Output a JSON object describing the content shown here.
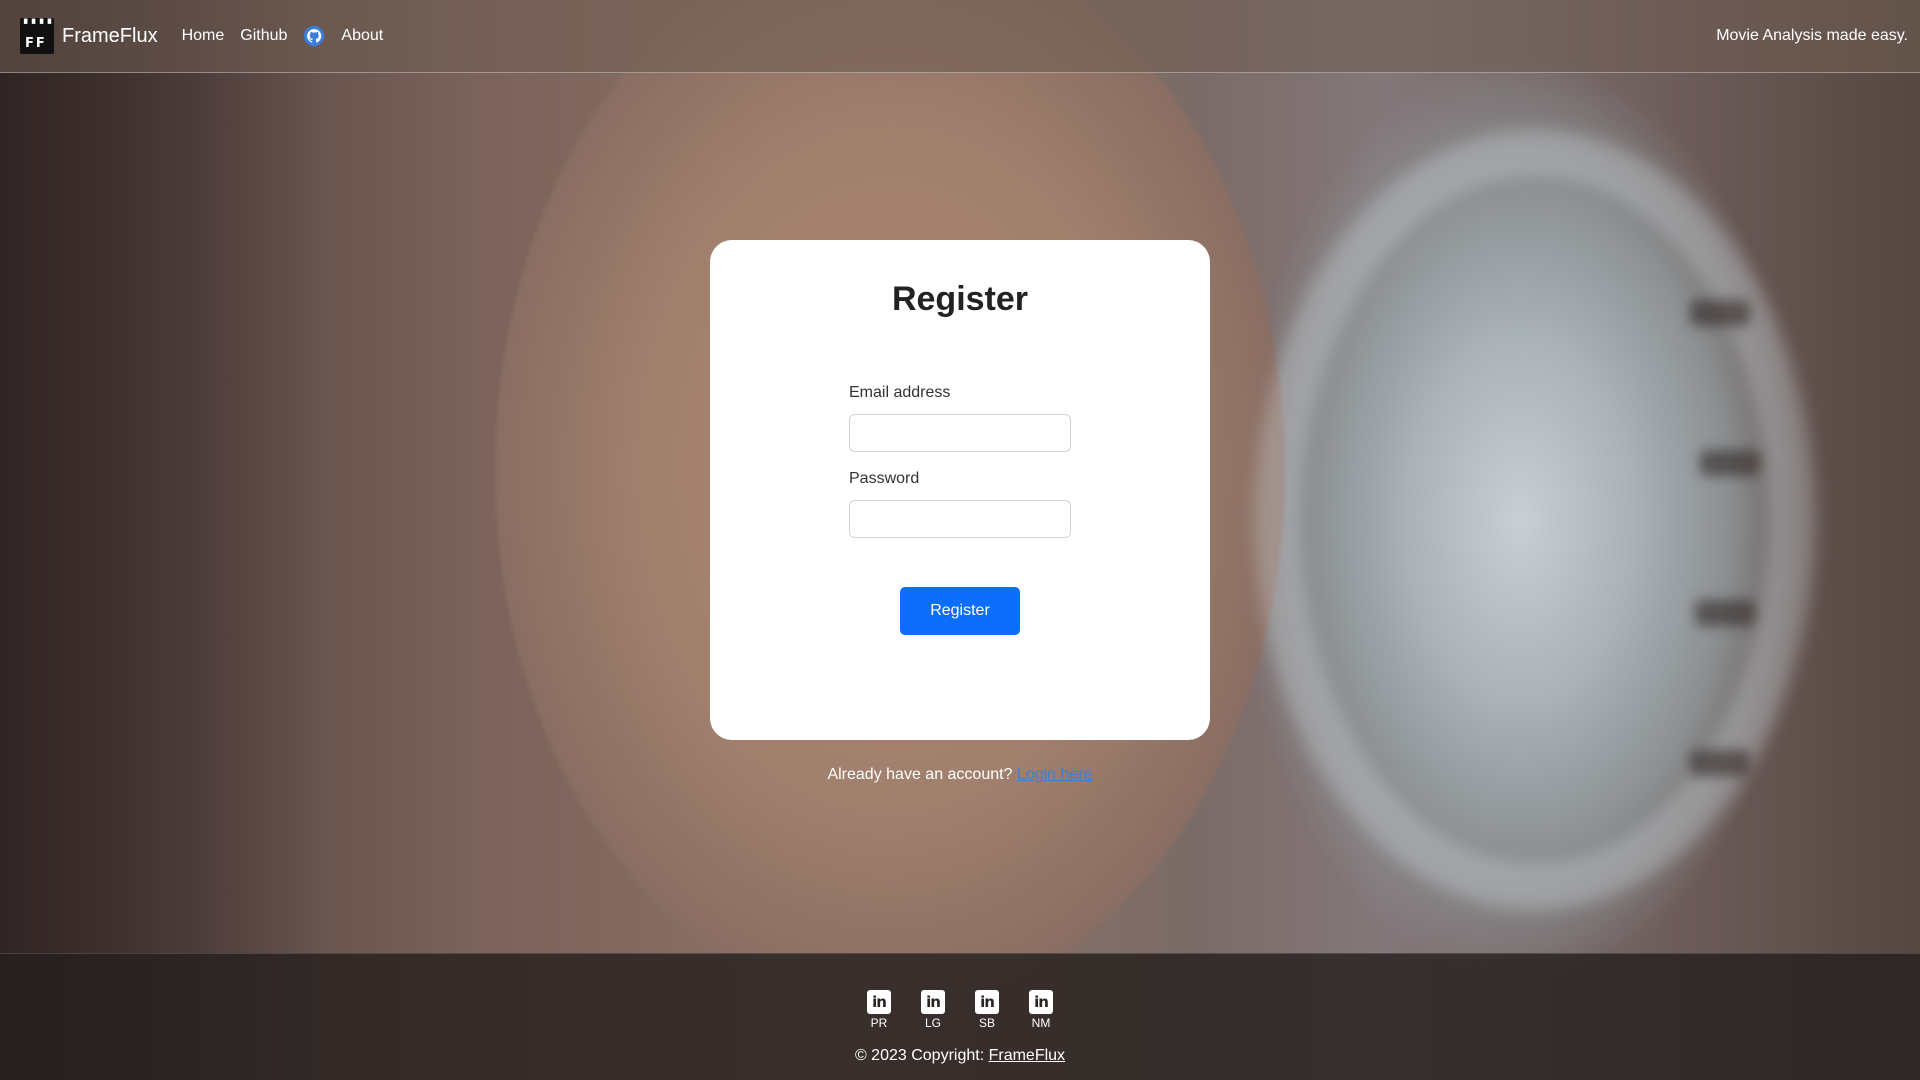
{
  "navbar": {
    "brand": "FrameFlux",
    "links": [
      {
        "label": "Home"
      },
      {
        "label": "Github"
      },
      {
        "label": "About"
      }
    ],
    "tagline": "Movie Analysis made easy."
  },
  "register_card": {
    "title": "Register",
    "email_label": "Email address",
    "email_value": "",
    "password_label": "Password",
    "password_value": "",
    "submit_label": "Register"
  },
  "login_prompt": {
    "text": "Already have an account?",
    "link_label": "Login here"
  },
  "footer": {
    "socials": [
      {
        "icon": "linkedin-icon",
        "label": "PR"
      },
      {
        "icon": "linkedin-icon",
        "label": "LG"
      },
      {
        "icon": "linkedin-icon",
        "label": "SB"
      },
      {
        "icon": "linkedin-icon",
        "label": "NM"
      }
    ],
    "copyright_text": "© 2023 Copyright:",
    "copyright_link": "FrameFlux"
  },
  "colors": {
    "primary_button": "#0d6efd",
    "link": "#3d7fd6"
  }
}
